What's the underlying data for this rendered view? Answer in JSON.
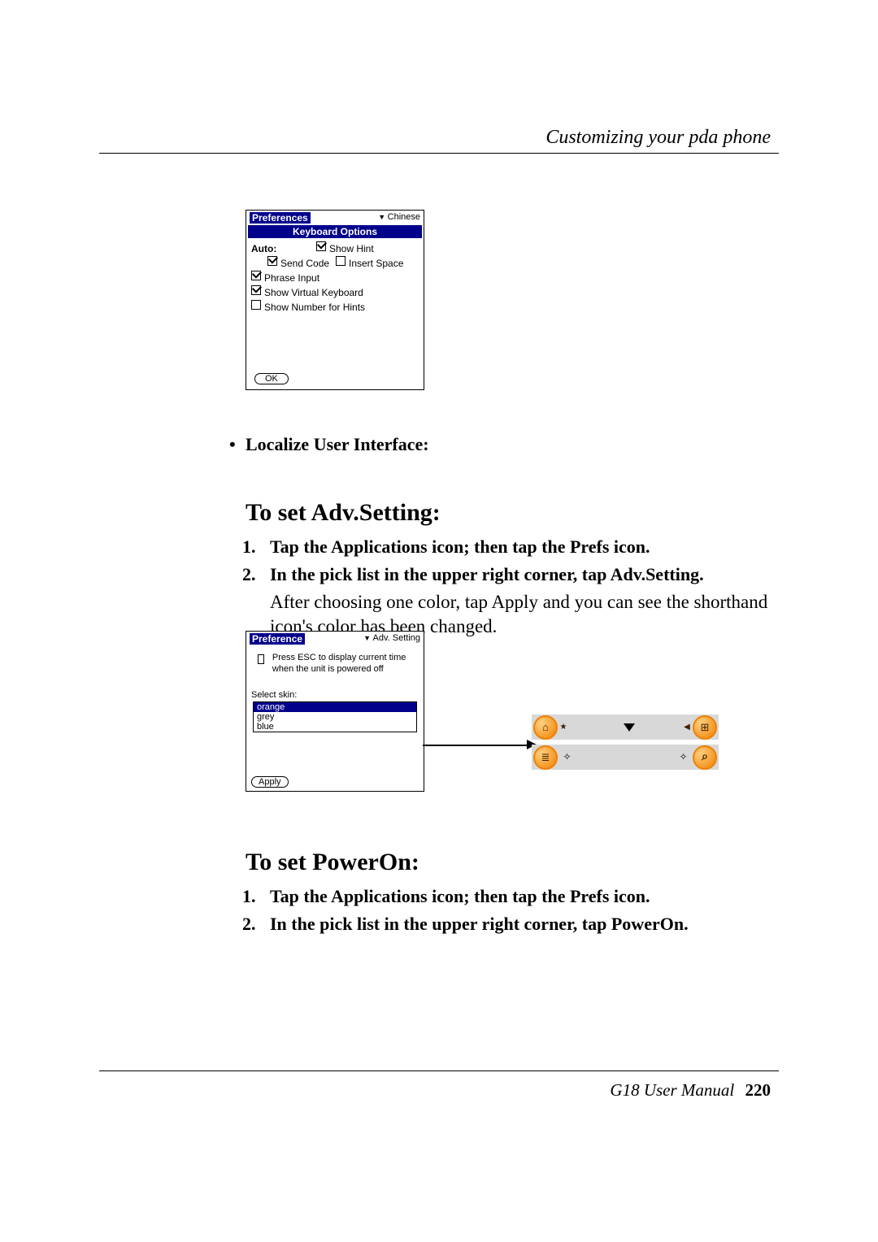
{
  "header": {
    "chapter": "Customizing your pda phone"
  },
  "footer": {
    "manual": "G18 User Manual",
    "page": "220"
  },
  "pda1": {
    "title": "Preferences",
    "dropdown": "Chinese",
    "subheader": "Keyboard Options",
    "auto_label": "Auto:",
    "opts": {
      "show_hint": {
        "label": "Show Hint",
        "checked": true
      },
      "send_code": {
        "label": "Send Code",
        "checked": true
      },
      "insert_space": {
        "label": "Insert Space",
        "checked": false
      },
      "phrase_input": {
        "label": "Phrase Input",
        "checked": true
      },
      "virtual_kb": {
        "label": "Show Virtual Keyboard",
        "checked": true
      },
      "num_hints": {
        "label": "Show Number for Hints",
        "checked": false
      }
    },
    "ok": "OK"
  },
  "bullet_localize": "Localize User Interface:",
  "section_adv": {
    "heading": "To set Adv.Setting:",
    "step1": "Tap the Applications icon; then tap the Prefs icon.",
    "step2": "In the pick list in the upper right corner, tap Adv.Setting.",
    "para": "After choosing one color, tap Apply and you can see the shorthand icon's color has been changed."
  },
  "pda2": {
    "title": "Preference",
    "dropdown": "Adv. Setting",
    "esc_text": "Press ESC to display current time when the unit is powered off",
    "skin_label": "Select skin:",
    "skins": [
      "orange",
      "grey",
      "blue"
    ],
    "selected_skin_index": 0,
    "apply": "Apply"
  },
  "section_poweron": {
    "heading": "To set PowerOn:",
    "step1": "Tap the Applications icon; then tap the Prefs icon.",
    "step2": "In the pick list in the upper right corner, tap PowerOn."
  }
}
